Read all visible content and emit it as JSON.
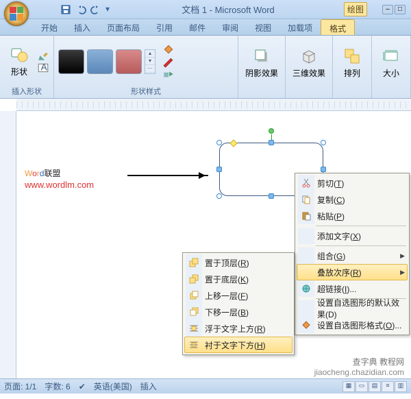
{
  "titlebar": {
    "doc_title": "文档 1 - Microsoft Word",
    "toolbox_label": "绘图",
    "minimize": "–",
    "restore": "□"
  },
  "tabs": {
    "items": [
      "开始",
      "插入",
      "页面布局",
      "引用",
      "邮件",
      "审阅",
      "视图",
      "加载项",
      "格式"
    ],
    "active_index": 8
  },
  "ribbon": {
    "group_insert": {
      "label": "插入形状",
      "shapes_btn": "形状"
    },
    "group_styles": {
      "label": "形状样式"
    },
    "group_shadow": {
      "label": "阴影效果",
      "btn": "阴影效果"
    },
    "group_3d": {
      "label": "三维效果",
      "btn": "三维效果"
    },
    "group_arrange": {
      "label": "排列",
      "btn": "排列"
    },
    "group_size": {
      "label": "大小",
      "btn": "大小"
    }
  },
  "document": {
    "watermark_text": "Word联盟",
    "watermark_url": "www.wordlm.com"
  },
  "context_menu_main": {
    "cut": "剪切(T)",
    "copy": "复制(C)",
    "paste": "粘贴(P)",
    "add_text": "添加文字(X)",
    "group": "组合(G)",
    "order": "叠放次序(R)",
    "hyperlink": "超链接(I)...",
    "set_default": "设置自选图形的默认效果(D)",
    "format_shape": "设置自选图形格式(O)..."
  },
  "context_menu_order": {
    "bring_front": "置于顶层(R)",
    "send_back": "置于底层(K)",
    "bring_forward": "上移一层(F)",
    "send_backward": "下移一层(B)",
    "in_front_text": "浮于文字上方(R)",
    "behind_text": "衬于文字下方(H)"
  },
  "status": {
    "page": "页面: 1/1",
    "words": "字数: 6",
    "lang": "英语(美国)",
    "mode": "插入"
  },
  "footer": {
    "site_cn": "查字典 教程网",
    "site_url": "jiaocheng.chazidian.com"
  }
}
